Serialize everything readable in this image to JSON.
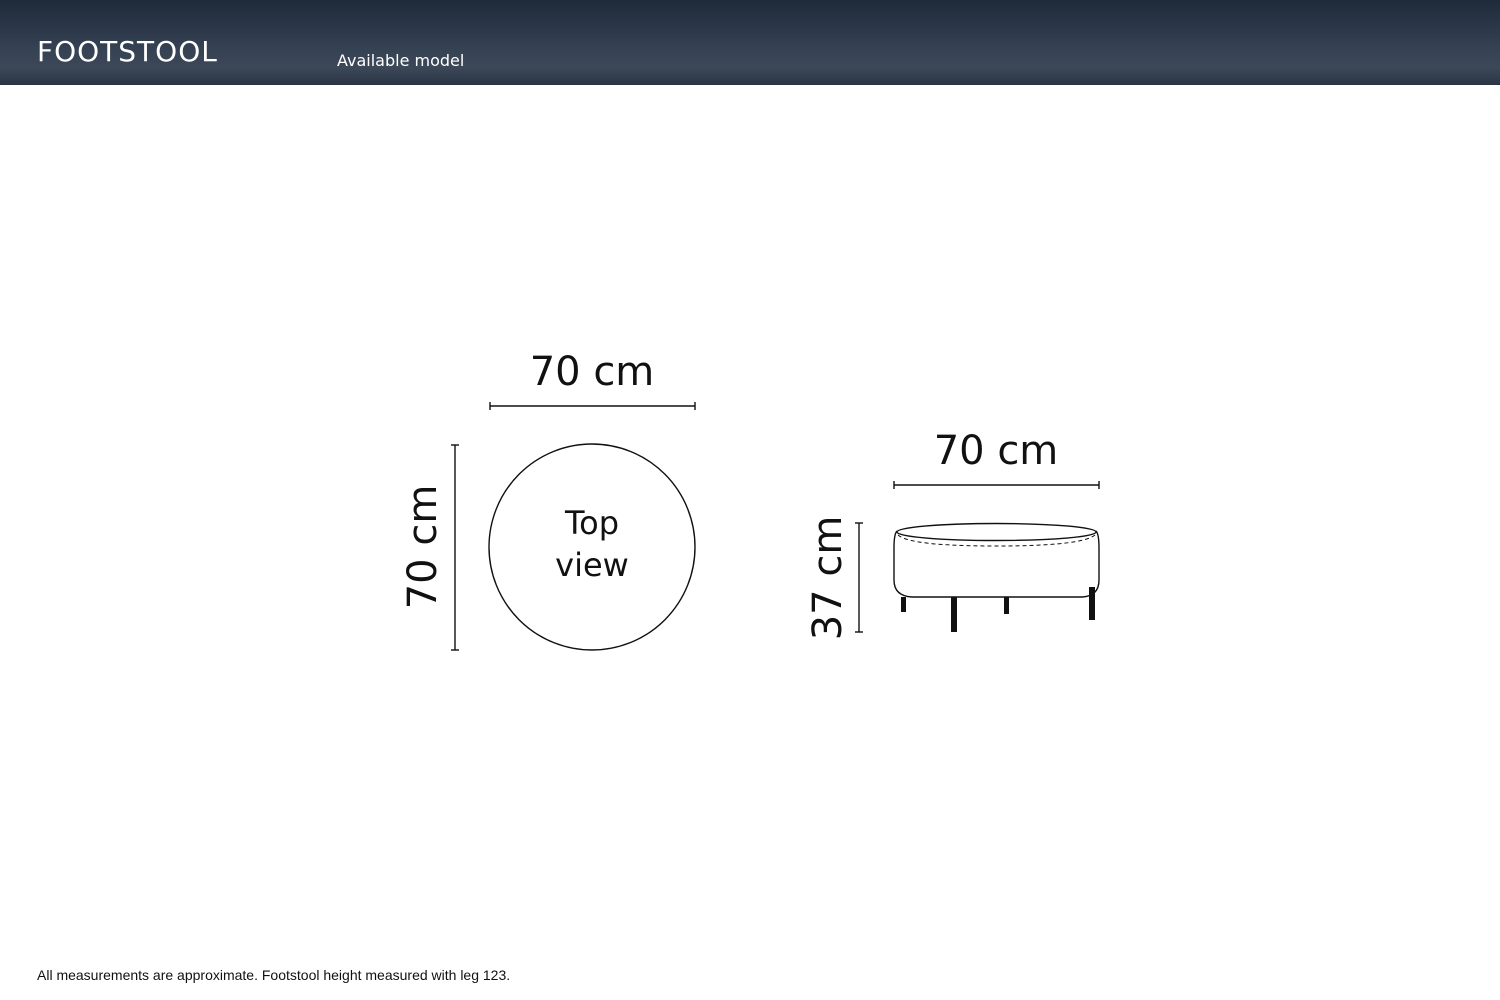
{
  "header": {
    "title": "FOOTSTOOL",
    "subtitle": "Available model"
  },
  "top_view": {
    "width_label": "70 cm",
    "depth_label": "70 cm",
    "caption_line1": "Top",
    "caption_line2": "view"
  },
  "side_view": {
    "width_label": "70 cm",
    "height_label": "37 cm"
  },
  "footer": {
    "note": "All measurements are approximate. Footstool height measured with leg 123."
  },
  "colors": {
    "header_background": "#364354",
    "line": "#111111"
  }
}
